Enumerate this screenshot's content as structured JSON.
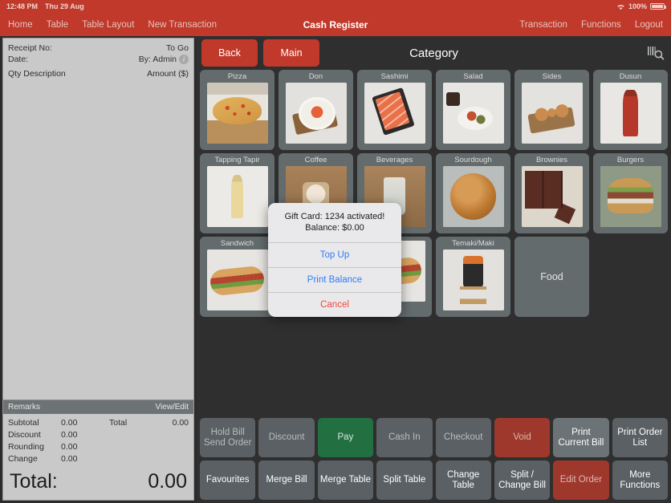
{
  "statusbar": {
    "time": "12:48 PM",
    "date": "Thu 29 Aug",
    "battery_pct": "100%",
    "wifi_icon": "wifi-icon",
    "battery_icon": "battery-icon"
  },
  "navbar": {
    "title": "Cash Register",
    "left_items": [
      {
        "label": "Home",
        "name": "nav-home"
      },
      {
        "label": "Table",
        "name": "nav-table"
      },
      {
        "label": "Table Layout",
        "name": "nav-table-layout"
      },
      {
        "label": "New Transaction",
        "name": "nav-new-transaction"
      }
    ],
    "right_items": [
      {
        "label": "Transaction",
        "name": "nav-transaction"
      },
      {
        "label": "Functions",
        "name": "nav-functions"
      },
      {
        "label": "Logout",
        "name": "nav-logout"
      }
    ]
  },
  "receipt": {
    "receipt_no_label": "Receipt No:",
    "receipt_no_value": "To Go",
    "date_label": "Date:",
    "date_value": "By: Admin",
    "info_icon": "info-icon",
    "col_qty_desc": "Qty  Description",
    "col_amount": "Amount ($)",
    "remarks_label": "Remarks",
    "remarks_action": "View/Edit",
    "totals": [
      {
        "label": "Subtotal",
        "value": "0.00"
      },
      {
        "label": "Discount",
        "value": "0.00"
      },
      {
        "label": "Rounding",
        "value": "0.00"
      },
      {
        "label": "Change",
        "value": "0.00"
      }
    ],
    "total_side_label": "Total",
    "total_side_value": "0.00",
    "grand_label": "Total:",
    "grand_value": "0.00"
  },
  "category": {
    "back_label": "Back",
    "main_label": "Main",
    "title": "Category",
    "barcode_search_icon": "barcode-search-icon",
    "tiles": [
      {
        "label": "Pizza",
        "art": "pizza",
        "type": "image"
      },
      {
        "label": "Don",
        "art": "don",
        "type": "image"
      },
      {
        "label": "Sashimi",
        "art": "sashimi",
        "type": "image"
      },
      {
        "label": "Salad",
        "art": "salad",
        "type": "image"
      },
      {
        "label": "Sides",
        "art": "sides",
        "type": "image"
      },
      {
        "label": "Dusun",
        "art": "bottle",
        "type": "image"
      },
      {
        "label": "Tapping Tapir",
        "art": "tapir",
        "type": "image"
      },
      {
        "label": "Coffee",
        "art": "coffee",
        "type": "image"
      },
      {
        "label": "Beverages",
        "art": "bev",
        "type": "image"
      },
      {
        "label": "Sourdough",
        "art": "sourdough",
        "type": "image"
      },
      {
        "label": "Brownies",
        "art": "brownies",
        "type": "image"
      },
      {
        "label": "Burgers",
        "art": "burger",
        "type": "image"
      },
      {
        "label": "Sandwich",
        "art": "sandwich",
        "type": "image"
      },
      {
        "label": "",
        "art": "coffee",
        "type": "image"
      },
      {
        "label": "",
        "art": "sandwich",
        "type": "image"
      },
      {
        "label": "Temaki/Maki",
        "art": "temaki",
        "type": "image"
      },
      {
        "label": "Food",
        "art": "",
        "type": "plain"
      }
    ]
  },
  "actions": {
    "row1": [
      {
        "label": "Hold Bill\nSend Order",
        "style": "",
        "name": "hold-bill-send-order-button"
      },
      {
        "label": "Discount",
        "style": "",
        "name": "discount-button"
      },
      {
        "label": "Pay",
        "style": "green",
        "name": "pay-button"
      },
      {
        "label": "Cash In",
        "style": "",
        "name": "cash-in-button"
      },
      {
        "label": "Checkout",
        "style": "",
        "name": "checkout-button"
      },
      {
        "label": "Void",
        "style": "red",
        "name": "void-button"
      },
      {
        "label": "Print\nCurrent Bill",
        "style": "light",
        "name": "print-current-bill-button"
      },
      {
        "label": "Print Order\nList",
        "style": "bright",
        "name": "print-order-list-button"
      }
    ],
    "row2": [
      {
        "label": "Favourites",
        "style": "bright",
        "name": "favourites-button"
      },
      {
        "label": "Merge Bill",
        "style": "bright",
        "name": "merge-bill-button"
      },
      {
        "label": "Merge Table",
        "style": "bright",
        "name": "merge-table-button"
      },
      {
        "label": "Split Table",
        "style": "bright",
        "name": "split-table-button"
      },
      {
        "label": "Change\nTable",
        "style": "bright",
        "name": "change-table-button"
      },
      {
        "label": "Split /\nChange Bill",
        "style": "bright",
        "name": "split-change-bill-button"
      },
      {
        "label": "Edit Order",
        "style": "red",
        "name": "edit-order-button"
      },
      {
        "label": "More\nFunctions",
        "style": "bright",
        "name": "more-functions-button"
      }
    ]
  },
  "modal": {
    "message_line1": "Gift Card: 1234 activated!",
    "message_line2": "Balance: $0.00",
    "buttons": [
      {
        "label": "Top Up",
        "style": "",
        "name": "modal-top-up-button"
      },
      {
        "label": "Print Balance",
        "style": "",
        "name": "modal-print-balance-button"
      },
      {
        "label": "Cancel",
        "style": "cancel",
        "name": "modal-cancel-button"
      }
    ]
  },
  "colors": {
    "brand_red": "#c0392b",
    "tile_gray": "#636b6d",
    "pay_green": "#226f42",
    "void_red": "#9e382c",
    "panel_gray": "#c9c9c9"
  }
}
